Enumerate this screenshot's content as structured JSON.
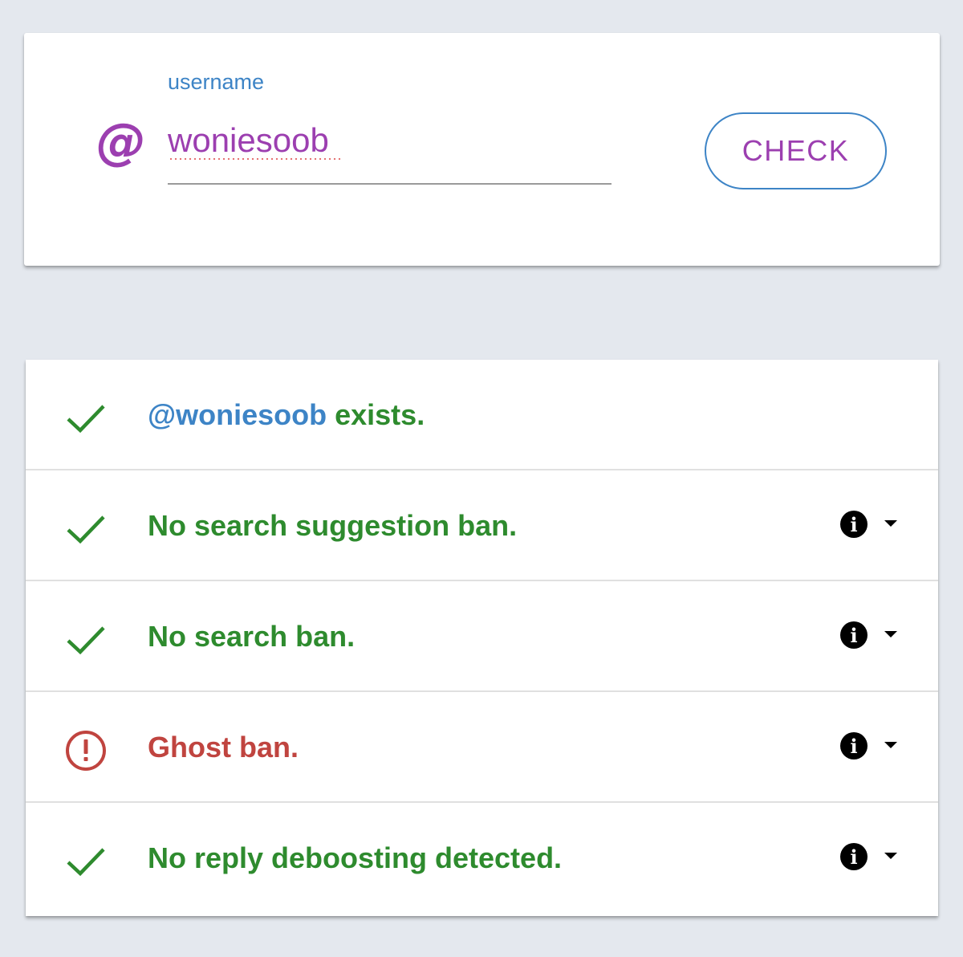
{
  "colors": {
    "purple": "#9c3fb0",
    "blue": "#3d84c6",
    "green": "#2e8b2e",
    "red": "#c0443f"
  },
  "search": {
    "at_symbol": "@",
    "label": "username",
    "value": "woniesoob",
    "check_label": "CHECK"
  },
  "results": {
    "exists": {
      "handle": "@woniesoob",
      "suffix": " exists.",
      "status": "ok",
      "icon": "check-icon"
    },
    "rows": [
      {
        "text": "No search suggestion ban.",
        "status": "ok",
        "icon": "check-icon",
        "info_icon": "info-icon",
        "expand_icon": "caret-down-icon"
      },
      {
        "text": "No search ban.",
        "status": "ok",
        "icon": "check-icon",
        "info_icon": "info-icon",
        "expand_icon": "caret-down-icon"
      },
      {
        "text": "Ghost ban.",
        "status": "error",
        "icon": "alert-circle-icon",
        "info_icon": "info-icon",
        "expand_icon": "caret-down-icon"
      },
      {
        "text": "No reply deboosting detected.",
        "status": "ok",
        "icon": "check-icon",
        "info_icon": "info-icon",
        "expand_icon": "caret-down-icon"
      }
    ],
    "info_glyph": "i"
  }
}
